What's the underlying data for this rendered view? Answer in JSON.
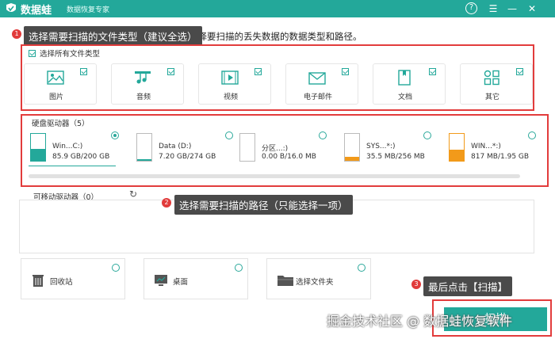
{
  "app": {
    "brand": "数据蛙",
    "subtitle": "数据恢复专家",
    "help_icon": "?",
    "menu_icon": "☰",
    "minimize_icon": "—",
    "close_icon": "✕"
  },
  "instruction": "选择要扫描的丢失数据的数据类型和路径。",
  "annotations": [
    {
      "badge": "1",
      "text": "选择需要扫描的文件类型（建议全选）"
    },
    {
      "badge": "2",
      "text": "选择需要扫描的路径（只能选择一项）"
    },
    {
      "badge": "3",
      "text": "最后点击【扫描】"
    }
  ],
  "file_types": {
    "select_all_label": "选择所有文件类型",
    "items": [
      {
        "label": "图片",
        "icon": "image-icon",
        "checked": true
      },
      {
        "label": "音频",
        "icon": "music-icon",
        "checked": true
      },
      {
        "label": "视频",
        "icon": "video-icon",
        "checked": true
      },
      {
        "label": "电子邮件",
        "icon": "email-icon",
        "checked": true
      },
      {
        "label": "文档",
        "icon": "document-icon",
        "checked": true
      },
      {
        "label": "其它",
        "icon": "other-icon",
        "checked": true
      }
    ]
  },
  "hard_drives": {
    "title": "硬盘驱动器（5）",
    "items": [
      {
        "name": "Win...C:)",
        "size": "85.9 GB/200 GB",
        "selected": true,
        "fill_fraction": 0.43,
        "color": "#23a89a"
      },
      {
        "name": "Data (D:)",
        "size": "7.20 GB/274 GB",
        "selected": false,
        "fill_fraction": 0.03,
        "color": "#23a89a"
      },
      {
        "name": "分区...:)",
        "size": "0.00  B/16.0 MB",
        "selected": false,
        "fill_fraction": 0.0,
        "color": "#f29a1a"
      },
      {
        "name": "SYS...*:)",
        "size": "35.5 MB/256 MB",
        "selected": false,
        "fill_fraction": 0.14,
        "color": "#f29a1a"
      },
      {
        "name": "WIN...*:)",
        "size": "817 MB/1.95 GB",
        "selected": false,
        "fill_fraction": 0.42,
        "color": "#f29a1a"
      }
    ]
  },
  "removable_drives": {
    "title": "可移动驱动器（0）",
    "refresh_icon": "↻"
  },
  "locations": [
    {
      "label": "回收站",
      "icon": "recycle-bin-icon"
    },
    {
      "label": "桌面",
      "icon": "desktop-icon"
    },
    {
      "label": "选择文件夹",
      "icon": "folder-icon"
    }
  ],
  "scan_button_label": "扫描",
  "watermark": "掘金技术社区 @ 数据蛙恢复软件",
  "colors": {
    "accent": "#23a89a",
    "annotation_red": "#e23c3c",
    "warning": "#f29a1a"
  }
}
